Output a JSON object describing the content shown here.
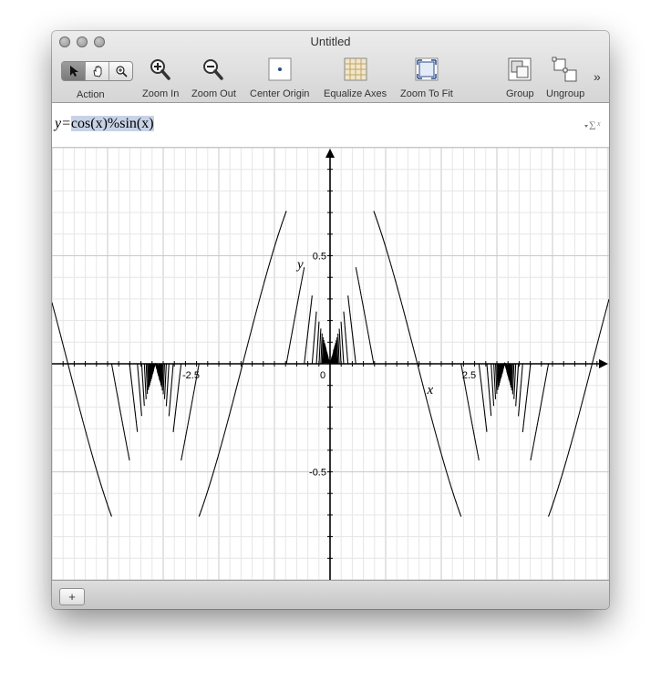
{
  "window": {
    "title": "Untitled"
  },
  "toolbar": {
    "action_label": "Action",
    "zoom_in_label": "Zoom In",
    "zoom_out_label": "Zoom Out",
    "center_origin_label": "Center Origin",
    "equalize_axes_label": "Equalize Axes",
    "zoom_to_fit_label": "Zoom To Fit",
    "group_label": "Group",
    "ungroup_label": "Ungroup",
    "overflow_icon": "double-chevron-right-icon"
  },
  "equation": {
    "prefix": "y=",
    "body": "cos(x)%sin(x)",
    "menu_icon": "sigma-menu-icon"
  },
  "chart_data": {
    "type": "line",
    "expression": "y=cos(x)%sin(x)",
    "xlabel": "x",
    "ylabel": "y",
    "xlim": [
      -5,
      5
    ],
    "ylim": [
      -1,
      1
    ],
    "x_tick_labels": [
      "-2.5",
      "0",
      "2.5"
    ],
    "y_tick_labels": [
      "0.5",
      "-0.5"
    ],
    "grid": true,
    "line_color": "#000000"
  },
  "bottom": {
    "add_label": "+"
  }
}
